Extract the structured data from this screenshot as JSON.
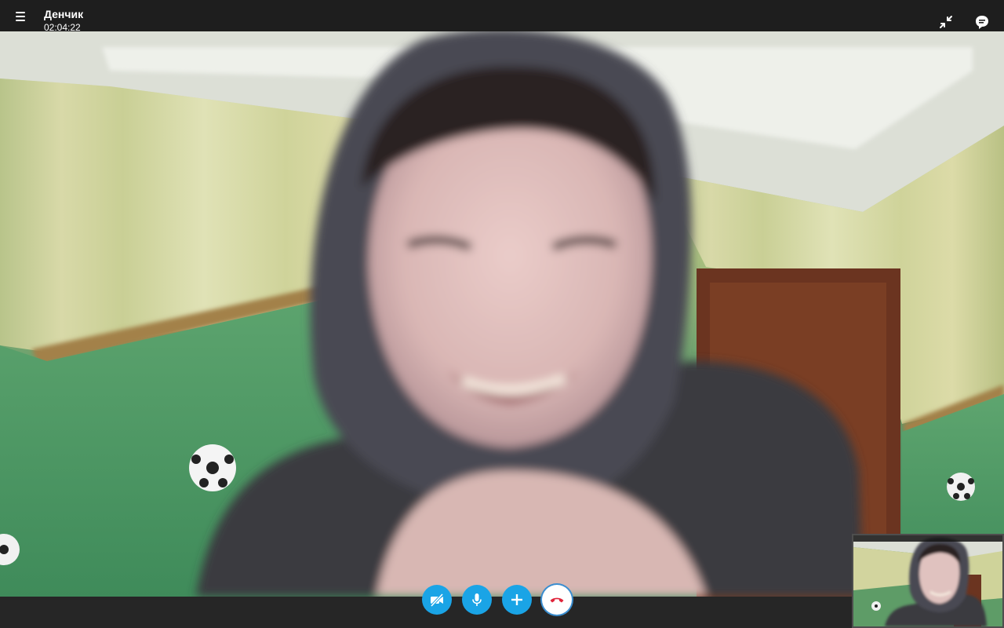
{
  "header": {
    "caller_name": "Денчик",
    "call_duration": "02:04:22"
  },
  "icons": {
    "menu": "hamburger-menu-icon",
    "minimize": "collapse-arrows-icon",
    "chat": "chat-bubble-icon",
    "video_off": "video-off-icon",
    "microphone": "microphone-icon",
    "add": "plus-icon",
    "end_call": "hang-up-phone-icon"
  },
  "colors": {
    "accent": "#1aa4e6",
    "end_call": "#e0243a",
    "top_bar": "#1e1e1e",
    "bottom_bar": "#262626"
  }
}
